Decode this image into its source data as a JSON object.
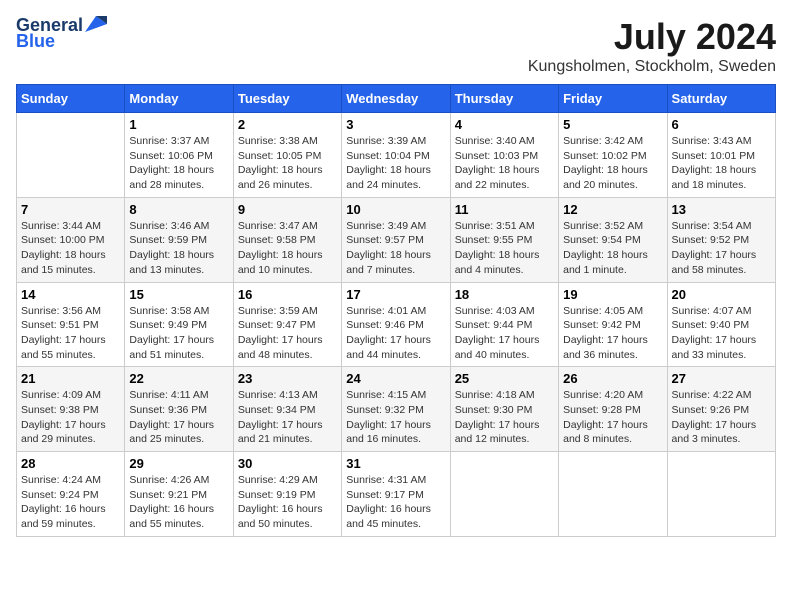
{
  "header": {
    "logo_general": "General",
    "logo_blue": "Blue",
    "month_year": "July 2024",
    "location": "Kungsholmen, Stockholm, Sweden"
  },
  "days_of_week": [
    "Sunday",
    "Monday",
    "Tuesday",
    "Wednesday",
    "Thursday",
    "Friday",
    "Saturday"
  ],
  "weeks": [
    [
      {
        "day": "",
        "sunrise": "",
        "sunset": "",
        "daylight": ""
      },
      {
        "day": "1",
        "sunrise": "Sunrise: 3:37 AM",
        "sunset": "Sunset: 10:06 PM",
        "daylight": "Daylight: 18 hours and 28 minutes."
      },
      {
        "day": "2",
        "sunrise": "Sunrise: 3:38 AM",
        "sunset": "Sunset: 10:05 PM",
        "daylight": "Daylight: 18 hours and 26 minutes."
      },
      {
        "day": "3",
        "sunrise": "Sunrise: 3:39 AM",
        "sunset": "Sunset: 10:04 PM",
        "daylight": "Daylight: 18 hours and 24 minutes."
      },
      {
        "day": "4",
        "sunrise": "Sunrise: 3:40 AM",
        "sunset": "Sunset: 10:03 PM",
        "daylight": "Daylight: 18 hours and 22 minutes."
      },
      {
        "day": "5",
        "sunrise": "Sunrise: 3:42 AM",
        "sunset": "Sunset: 10:02 PM",
        "daylight": "Daylight: 18 hours and 20 minutes."
      },
      {
        "day": "6",
        "sunrise": "Sunrise: 3:43 AM",
        "sunset": "Sunset: 10:01 PM",
        "daylight": "Daylight: 18 hours and 18 minutes."
      }
    ],
    [
      {
        "day": "7",
        "sunrise": "Sunrise: 3:44 AM",
        "sunset": "Sunset: 10:00 PM",
        "daylight": "Daylight: 18 hours and 15 minutes."
      },
      {
        "day": "8",
        "sunrise": "Sunrise: 3:46 AM",
        "sunset": "Sunset: 9:59 PM",
        "daylight": "Daylight: 18 hours and 13 minutes."
      },
      {
        "day": "9",
        "sunrise": "Sunrise: 3:47 AM",
        "sunset": "Sunset: 9:58 PM",
        "daylight": "Daylight: 18 hours and 10 minutes."
      },
      {
        "day": "10",
        "sunrise": "Sunrise: 3:49 AM",
        "sunset": "Sunset: 9:57 PM",
        "daylight": "Daylight: 18 hours and 7 minutes."
      },
      {
        "day": "11",
        "sunrise": "Sunrise: 3:51 AM",
        "sunset": "Sunset: 9:55 PM",
        "daylight": "Daylight: 18 hours and 4 minutes."
      },
      {
        "day": "12",
        "sunrise": "Sunrise: 3:52 AM",
        "sunset": "Sunset: 9:54 PM",
        "daylight": "Daylight: 18 hours and 1 minute."
      },
      {
        "day": "13",
        "sunrise": "Sunrise: 3:54 AM",
        "sunset": "Sunset: 9:52 PM",
        "daylight": "Daylight: 17 hours and 58 minutes."
      }
    ],
    [
      {
        "day": "14",
        "sunrise": "Sunrise: 3:56 AM",
        "sunset": "Sunset: 9:51 PM",
        "daylight": "Daylight: 17 hours and 55 minutes."
      },
      {
        "day": "15",
        "sunrise": "Sunrise: 3:58 AM",
        "sunset": "Sunset: 9:49 PM",
        "daylight": "Daylight: 17 hours and 51 minutes."
      },
      {
        "day": "16",
        "sunrise": "Sunrise: 3:59 AM",
        "sunset": "Sunset: 9:47 PM",
        "daylight": "Daylight: 17 hours and 48 minutes."
      },
      {
        "day": "17",
        "sunrise": "Sunrise: 4:01 AM",
        "sunset": "Sunset: 9:46 PM",
        "daylight": "Daylight: 17 hours and 44 minutes."
      },
      {
        "day": "18",
        "sunrise": "Sunrise: 4:03 AM",
        "sunset": "Sunset: 9:44 PM",
        "daylight": "Daylight: 17 hours and 40 minutes."
      },
      {
        "day": "19",
        "sunrise": "Sunrise: 4:05 AM",
        "sunset": "Sunset: 9:42 PM",
        "daylight": "Daylight: 17 hours and 36 minutes."
      },
      {
        "day": "20",
        "sunrise": "Sunrise: 4:07 AM",
        "sunset": "Sunset: 9:40 PM",
        "daylight": "Daylight: 17 hours and 33 minutes."
      }
    ],
    [
      {
        "day": "21",
        "sunrise": "Sunrise: 4:09 AM",
        "sunset": "Sunset: 9:38 PM",
        "daylight": "Daylight: 17 hours and 29 minutes."
      },
      {
        "day": "22",
        "sunrise": "Sunrise: 4:11 AM",
        "sunset": "Sunset: 9:36 PM",
        "daylight": "Daylight: 17 hours and 25 minutes."
      },
      {
        "day": "23",
        "sunrise": "Sunrise: 4:13 AM",
        "sunset": "Sunset: 9:34 PM",
        "daylight": "Daylight: 17 hours and 21 minutes."
      },
      {
        "day": "24",
        "sunrise": "Sunrise: 4:15 AM",
        "sunset": "Sunset: 9:32 PM",
        "daylight": "Daylight: 17 hours and 16 minutes."
      },
      {
        "day": "25",
        "sunrise": "Sunrise: 4:18 AM",
        "sunset": "Sunset: 9:30 PM",
        "daylight": "Daylight: 17 hours and 12 minutes."
      },
      {
        "day": "26",
        "sunrise": "Sunrise: 4:20 AM",
        "sunset": "Sunset: 9:28 PM",
        "daylight": "Daylight: 17 hours and 8 minutes."
      },
      {
        "day": "27",
        "sunrise": "Sunrise: 4:22 AM",
        "sunset": "Sunset: 9:26 PM",
        "daylight": "Daylight: 17 hours and 3 minutes."
      }
    ],
    [
      {
        "day": "28",
        "sunrise": "Sunrise: 4:24 AM",
        "sunset": "Sunset: 9:24 PM",
        "daylight": "Daylight: 16 hours and 59 minutes."
      },
      {
        "day": "29",
        "sunrise": "Sunrise: 4:26 AM",
        "sunset": "Sunset: 9:21 PM",
        "daylight": "Daylight: 16 hours and 55 minutes."
      },
      {
        "day": "30",
        "sunrise": "Sunrise: 4:29 AM",
        "sunset": "Sunset: 9:19 PM",
        "daylight": "Daylight: 16 hours and 50 minutes."
      },
      {
        "day": "31",
        "sunrise": "Sunrise: 4:31 AM",
        "sunset": "Sunset: 9:17 PM",
        "daylight": "Daylight: 16 hours and 45 minutes."
      },
      {
        "day": "",
        "sunrise": "",
        "sunset": "",
        "daylight": ""
      },
      {
        "day": "",
        "sunrise": "",
        "sunset": "",
        "daylight": ""
      },
      {
        "day": "",
        "sunrise": "",
        "sunset": "",
        "daylight": ""
      }
    ]
  ]
}
